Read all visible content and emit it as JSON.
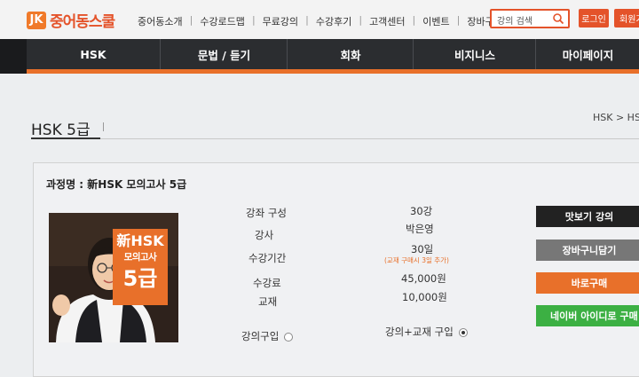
{
  "brand": {
    "logo_mark": "JK",
    "name": "중어동스쿨"
  },
  "topnav": {
    "items": [
      "중어동소개",
      "수강로드맵",
      "무료강의",
      "수강후기",
      "고객센터",
      "이벤트",
      "장바구니"
    ]
  },
  "search": {
    "placeholder": "강의 검색",
    "icon": "search-icon"
  },
  "auth": {
    "login_label": "로그인",
    "join_label": "회원가"
  },
  "mainnav": {
    "items": [
      "HSK",
      "문법 / 듣기",
      "회화",
      "비지니스",
      "마이페이지"
    ]
  },
  "page": {
    "title": "HSK 5급",
    "breadcrumb": "HSK > HSK"
  },
  "course": {
    "name_line": "과정명 : 新HSK 모의고사 5급",
    "thumbnail": {
      "line1": "新HSK",
      "line2": "모의고사",
      "line3": "5급"
    },
    "rows": [
      {
        "label": "강좌 구성",
        "value": "30강"
      },
      {
        "label": "강사",
        "value": "박은영"
      },
      {
        "label": "수강기간",
        "value": "30일",
        "note": "(교재 구매시 3일 추가)"
      },
      {
        "label": "수강료",
        "value": "45,000원"
      },
      {
        "label": "교재",
        "value": "10,000원"
      }
    ],
    "options": {
      "lecture_only": "강의구입",
      "lecture_book": "강의+교재 구입",
      "selected": "lecture_book"
    }
  },
  "actions": {
    "sample": "맛보기 강의",
    "cart": "장바구니담기",
    "buy": "바로구매",
    "naver": "네이버 아이디로 구매"
  },
  "colors": {
    "accent": "#e8702a",
    "brand_red": "#e4532a",
    "nav_bg": "#2b2d30",
    "naver_green": "#3cb043"
  }
}
